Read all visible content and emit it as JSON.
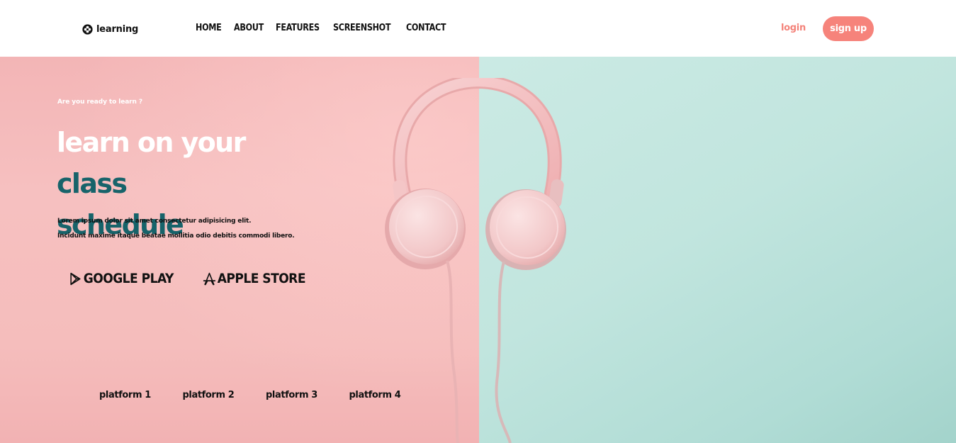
{
  "header": {
    "brand": {
      "icon": "flower-badge-icon",
      "name": "learning"
    },
    "nav": [
      {
        "label": "HOME"
      },
      {
        "label": "ABOUT"
      },
      {
        "label": "FEATURES"
      },
      {
        "label": "SCREENSHOT"
      },
      {
        "label": "CONTACT"
      }
    ],
    "login": "login",
    "signup": "sign up"
  },
  "hero": {
    "eyebrow": "Are you ready to learn ?",
    "headline": {
      "part1": "learn on your ",
      "part2": "class",
      "part3": "schedule"
    },
    "lead_line_1": "Lorem ipsum dolor sit amet consectetur adipisicing elit.",
    "lead_line_2": "Incidunt maxime itaque beatae mollitia odio debitis commodi libero.",
    "stores": [
      {
        "icon": "play-store-icon",
        "label": "GOOGLE PLAY"
      },
      {
        "icon": "app-store-icon",
        "label": "APPLE STORE"
      }
    ],
    "platforms": [
      "platform 1",
      "platform 2",
      "platform 3",
      "platform 4"
    ],
    "image": "pink-headphones-on-split-background"
  },
  "colors": {
    "accent": "#f6837b",
    "teal": "#17636a",
    "pink_background": "#f6c0c0",
    "mint_background": "#c1e5de"
  }
}
